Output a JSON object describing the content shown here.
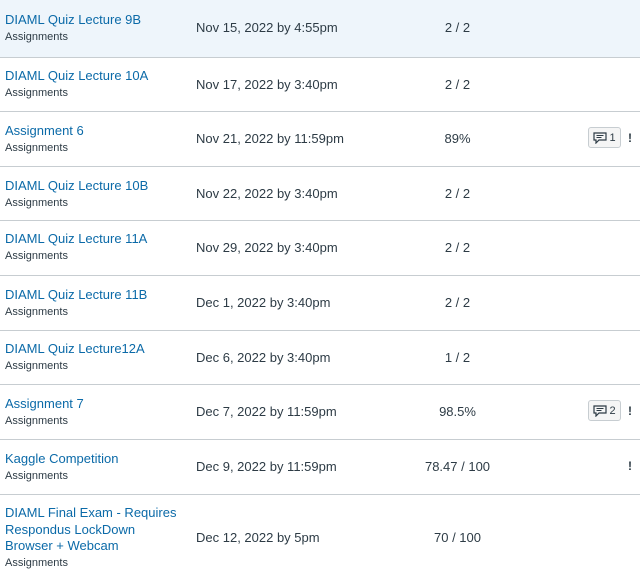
{
  "assignments": [
    {
      "title": "DIAML Quiz Lecture 9B",
      "context": "Assignments",
      "due": "Nov 15, 2022 by 4:55pm",
      "score": "2 / 2"
    },
    {
      "title": "DIAML Quiz Lecture 10A",
      "context": "Assignments",
      "due": "Nov 17, 2022 by 3:40pm",
      "score": "2 / 2"
    },
    {
      "title": "Assignment 6",
      "context": "Assignments",
      "due": "Nov 21, 2022 by 11:59pm",
      "score": "89%",
      "comments": "1",
      "flag": "!"
    },
    {
      "title": "DIAML Quiz Lecture 10B",
      "context": "Assignments",
      "due": "Nov 22, 2022 by 3:40pm",
      "score": "2 / 2"
    },
    {
      "title": "DIAML Quiz Lecture 11A",
      "context": "Assignments",
      "due": "Nov 29, 2022 by 3:40pm",
      "score": "2 / 2"
    },
    {
      "title": "DIAML Quiz Lecture 11B",
      "context": "Assignments",
      "due": "Dec 1, 2022 by 3:40pm",
      "score": "2 / 2"
    },
    {
      "title": "DIAML Quiz Lecture12A",
      "context": "Assignments",
      "due": "Dec 6, 2022 by 3:40pm",
      "score": "1 / 2"
    },
    {
      "title": "Assignment 7",
      "context": "Assignments",
      "due": "Dec 7, 2022 by 11:59pm",
      "score": "98.5%",
      "comments": "2",
      "flag": "!"
    },
    {
      "title": "Kaggle Competition",
      "context": "Assignments",
      "due": "Dec 9, 2022 by 11:59pm",
      "score": "78.47 / 100",
      "flag": "!"
    },
    {
      "title_lines": [
        "DIAML Final Exam - Requires",
        "Respondus LockDown",
        "Browser + Webcam"
      ],
      "context": "Assignments",
      "due": "Dec 12, 2022 by 5pm",
      "score": "70 / 100"
    }
  ],
  "icons": {
    "comment": "speech-bubble-icon"
  },
  "colors": {
    "link": "#0b6aa8",
    "highlight_row": "#eef5fb",
    "divider": "#c7cdd1"
  }
}
